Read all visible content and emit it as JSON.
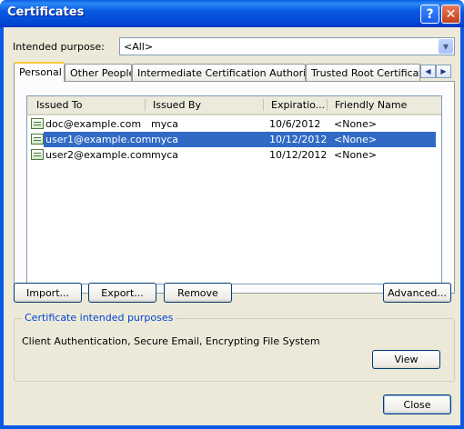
{
  "window": {
    "title": "Certificates",
    "help_glyph": "?",
    "close_glyph": "✕"
  },
  "purpose": {
    "label": "Intended purpose:",
    "value": "<All>"
  },
  "tabs": [
    {
      "label": "Personal",
      "active": true
    },
    {
      "label": "Other People",
      "active": false
    },
    {
      "label": "Intermediate Certification Authorities",
      "active": false
    },
    {
      "label": "Trusted Root Certification Authorities",
      "active": false
    }
  ],
  "list": {
    "columns": [
      "Issued To",
      "Issued By",
      "Expiratio...",
      "Friendly Name"
    ],
    "rows": [
      {
        "issued_to": "doc@example.com",
        "issued_by": "myca",
        "expiration": "10/6/2012",
        "friendly_name": "<None>",
        "selected": false
      },
      {
        "issued_to": "user1@example.com",
        "issued_by": "myca",
        "expiration": "10/12/2012",
        "friendly_name": "<None>",
        "selected": true
      },
      {
        "issued_to": "user2@example.com",
        "issued_by": "myca",
        "expiration": "10/12/2012",
        "friendly_name": "<None>",
        "selected": false
      }
    ]
  },
  "buttons": {
    "import": "Import...",
    "export": "Export...",
    "remove": "Remove",
    "advanced": "Advanced...",
    "view": "View",
    "close": "Close"
  },
  "purposes_group": {
    "title": "Certificate intended purposes",
    "text": "Client Authentication, Secure Email, Encrypting File System"
  },
  "colors": {
    "titlebar": "#0a5ae3",
    "selection": "#316ac5",
    "group_title": "#0046d5",
    "dialog_bg": "#ece9d8"
  }
}
